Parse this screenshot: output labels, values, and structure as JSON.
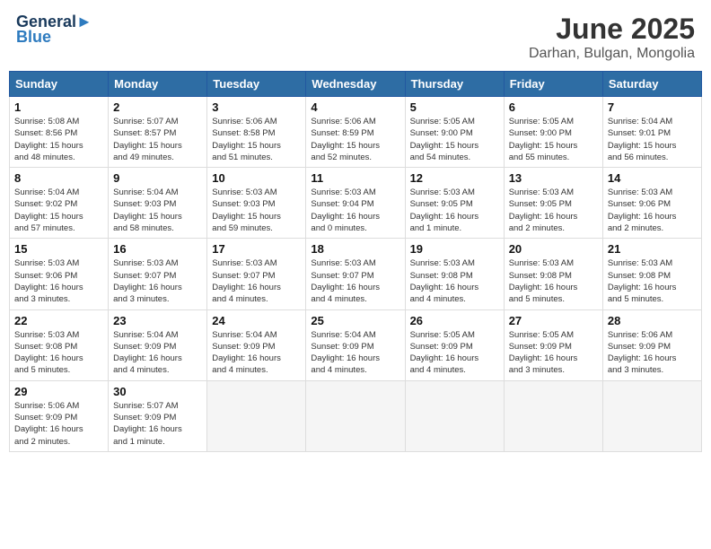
{
  "header": {
    "logo_general": "General",
    "logo_blue": "Blue",
    "month_year": "June 2025",
    "location": "Darhan, Bulgan, Mongolia"
  },
  "days_of_week": [
    "Sunday",
    "Monday",
    "Tuesday",
    "Wednesday",
    "Thursday",
    "Friday",
    "Saturday"
  ],
  "weeks": [
    [
      {
        "day": 1,
        "info": "Sunrise: 5:08 AM\nSunset: 8:56 PM\nDaylight: 15 hours\nand 48 minutes."
      },
      {
        "day": 2,
        "info": "Sunrise: 5:07 AM\nSunset: 8:57 PM\nDaylight: 15 hours\nand 49 minutes."
      },
      {
        "day": 3,
        "info": "Sunrise: 5:06 AM\nSunset: 8:58 PM\nDaylight: 15 hours\nand 51 minutes."
      },
      {
        "day": 4,
        "info": "Sunrise: 5:06 AM\nSunset: 8:59 PM\nDaylight: 15 hours\nand 52 minutes."
      },
      {
        "day": 5,
        "info": "Sunrise: 5:05 AM\nSunset: 9:00 PM\nDaylight: 15 hours\nand 54 minutes."
      },
      {
        "day": 6,
        "info": "Sunrise: 5:05 AM\nSunset: 9:00 PM\nDaylight: 15 hours\nand 55 minutes."
      },
      {
        "day": 7,
        "info": "Sunrise: 5:04 AM\nSunset: 9:01 PM\nDaylight: 15 hours\nand 56 minutes."
      }
    ],
    [
      {
        "day": 8,
        "info": "Sunrise: 5:04 AM\nSunset: 9:02 PM\nDaylight: 15 hours\nand 57 minutes."
      },
      {
        "day": 9,
        "info": "Sunrise: 5:04 AM\nSunset: 9:03 PM\nDaylight: 15 hours\nand 58 minutes."
      },
      {
        "day": 10,
        "info": "Sunrise: 5:03 AM\nSunset: 9:03 PM\nDaylight: 15 hours\nand 59 minutes."
      },
      {
        "day": 11,
        "info": "Sunrise: 5:03 AM\nSunset: 9:04 PM\nDaylight: 16 hours\nand 0 minutes."
      },
      {
        "day": 12,
        "info": "Sunrise: 5:03 AM\nSunset: 9:05 PM\nDaylight: 16 hours\nand 1 minute."
      },
      {
        "day": 13,
        "info": "Sunrise: 5:03 AM\nSunset: 9:05 PM\nDaylight: 16 hours\nand 2 minutes."
      },
      {
        "day": 14,
        "info": "Sunrise: 5:03 AM\nSunset: 9:06 PM\nDaylight: 16 hours\nand 2 minutes."
      }
    ],
    [
      {
        "day": 15,
        "info": "Sunrise: 5:03 AM\nSunset: 9:06 PM\nDaylight: 16 hours\nand 3 minutes."
      },
      {
        "day": 16,
        "info": "Sunrise: 5:03 AM\nSunset: 9:07 PM\nDaylight: 16 hours\nand 3 minutes."
      },
      {
        "day": 17,
        "info": "Sunrise: 5:03 AM\nSunset: 9:07 PM\nDaylight: 16 hours\nand 4 minutes."
      },
      {
        "day": 18,
        "info": "Sunrise: 5:03 AM\nSunset: 9:07 PM\nDaylight: 16 hours\nand 4 minutes."
      },
      {
        "day": 19,
        "info": "Sunrise: 5:03 AM\nSunset: 9:08 PM\nDaylight: 16 hours\nand 4 minutes."
      },
      {
        "day": 20,
        "info": "Sunrise: 5:03 AM\nSunset: 9:08 PM\nDaylight: 16 hours\nand 5 minutes."
      },
      {
        "day": 21,
        "info": "Sunrise: 5:03 AM\nSunset: 9:08 PM\nDaylight: 16 hours\nand 5 minutes."
      }
    ],
    [
      {
        "day": 22,
        "info": "Sunrise: 5:03 AM\nSunset: 9:08 PM\nDaylight: 16 hours\nand 5 minutes."
      },
      {
        "day": 23,
        "info": "Sunrise: 5:04 AM\nSunset: 9:09 PM\nDaylight: 16 hours\nand 4 minutes."
      },
      {
        "day": 24,
        "info": "Sunrise: 5:04 AM\nSunset: 9:09 PM\nDaylight: 16 hours\nand 4 minutes."
      },
      {
        "day": 25,
        "info": "Sunrise: 5:04 AM\nSunset: 9:09 PM\nDaylight: 16 hours\nand 4 minutes."
      },
      {
        "day": 26,
        "info": "Sunrise: 5:05 AM\nSunset: 9:09 PM\nDaylight: 16 hours\nand 4 minutes."
      },
      {
        "day": 27,
        "info": "Sunrise: 5:05 AM\nSunset: 9:09 PM\nDaylight: 16 hours\nand 3 minutes."
      },
      {
        "day": 28,
        "info": "Sunrise: 5:06 AM\nSunset: 9:09 PM\nDaylight: 16 hours\nand 3 minutes."
      }
    ],
    [
      {
        "day": 29,
        "info": "Sunrise: 5:06 AM\nSunset: 9:09 PM\nDaylight: 16 hours\nand 2 minutes."
      },
      {
        "day": 30,
        "info": "Sunrise: 5:07 AM\nSunset: 9:09 PM\nDaylight: 16 hours\nand 1 minute."
      },
      {
        "day": null,
        "info": ""
      },
      {
        "day": null,
        "info": ""
      },
      {
        "day": null,
        "info": ""
      },
      {
        "day": null,
        "info": ""
      },
      {
        "day": null,
        "info": ""
      }
    ]
  ]
}
